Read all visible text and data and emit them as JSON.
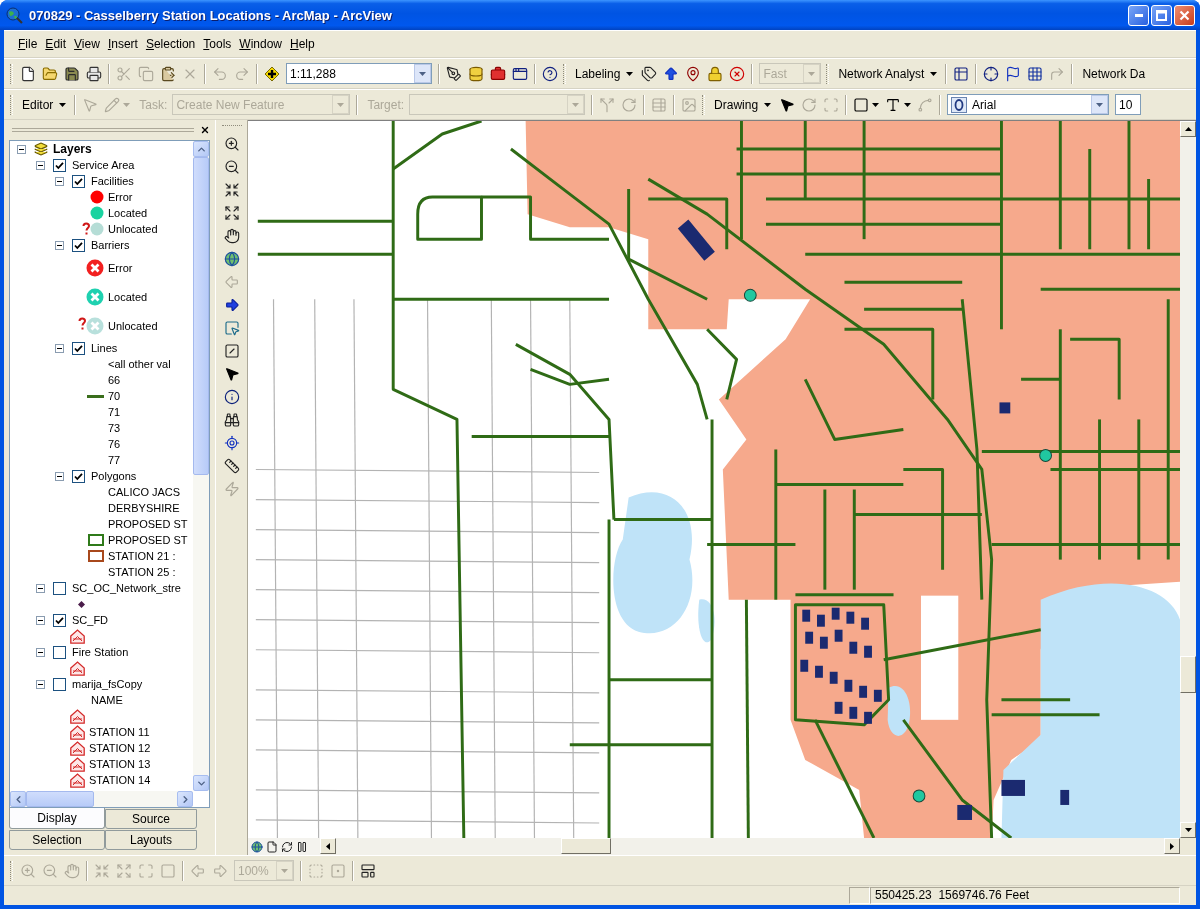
{
  "window": {
    "title": "070829 - Casselberry Station Locations - ArcMap - ArcView"
  },
  "menu_bar": [
    "File",
    "Edit",
    "View",
    "Insert",
    "Selection",
    "Tools",
    "Window",
    "Help"
  ],
  "standard_toolbar": {
    "tools": [
      {
        "disabled": false
      },
      {
        "disabled": false
      },
      {
        "disabled": false
      },
      {
        "disabled": false
      },
      {
        "disabled": true
      },
      {
        "disabled": true
      },
      {
        "disabled": false
      },
      {
        "disabled": true
      },
      {
        "disabled": true
      },
      {
        "disabled": true
      },
      {
        "disabled": false
      },
      {
        "disabled": false
      },
      {
        "disabled": false
      },
      {
        "disabled": false
      },
      {
        "disabled": false
      },
      {
        "disabled": false
      },
      {
        "disabled": false
      },
      {
        "disabled": false
      },
      {
        "disabled": false
      },
      {
        "disabled": false
      },
      {
        "disabled": false
      },
      {
        "disabled": false
      },
      {
        "disabled": false
      },
      {
        "disabled": false
      },
      {
        "disabled": false
      },
      {
        "disabled": true
      }
    ],
    "scale": "1:11,288",
    "labeling_menu": "Labeling",
    "priority_combo": {
      "value": "Fast",
      "disabled": true
    },
    "network_analyst_menu": "Network Analyst",
    "network_dataset_label": "Network Da"
  },
  "editor_toolbar": {
    "editor_menu": "Editor",
    "tools": [
      {
        "disabled": true
      },
      {
        "disabled": true
      },
      {
        "disabled": true
      },
      {
        "disabled": true
      },
      {
        "disabled": true
      },
      {
        "disabled": true
      },
      {
        "disabled": false
      },
      {
        "disabled": true
      },
      {
        "disabled": true
      },
      {
        "disabled": false
      },
      {
        "disabled": false
      },
      {
        "disabled": true
      }
    ],
    "task": {
      "label": "Task:",
      "value": "Create New Feature",
      "disabled": true
    },
    "target": {
      "label": "Target:",
      "disabled": true
    },
    "drawing_menu": "Drawing",
    "font": "Arial",
    "font_size": "10"
  },
  "tools_column": {
    "tools": [
      {
        "disabled": false
      },
      {
        "disabled": false
      },
      {
        "disabled": false
      },
      {
        "disabled": false
      },
      {
        "disabled": false
      },
      {
        "disabled": false
      },
      {
        "disabled": true
      },
      {
        "disabled": false
      },
      {
        "disabled": false
      },
      {
        "disabled": false
      },
      {
        "disabled": false
      },
      {
        "disabled": false
      },
      {
        "disabled": false
      },
      {
        "disabled": false
      },
      {
        "disabled": false
      },
      {
        "disabled": true
      }
    ]
  },
  "table_of_contents": {
    "tree": [
      {
        "kind": "data-frame",
        "label": "Layers",
        "expanded": true,
        "children": [
          {
            "kind": "layer",
            "label": "Service Area",
            "checked": true,
            "expanded": true,
            "children": [
              {
                "kind": "layer",
                "label": "Facilities",
                "checked": true,
                "expanded": true,
                "children": [
                  {
                    "kind": "point",
                    "label": "Error",
                    "color": "#ff0000"
                  },
                  {
                    "kind": "point",
                    "label": "Located",
                    "color": "#19d3a0"
                  },
                  {
                    "kind": "unlocated-point",
                    "label": "Unlocated",
                    "color": "#b5ddd6"
                  }
                ]
              },
              {
                "kind": "layer",
                "label": "Barriers",
                "checked": true,
                "expanded": true,
                "children": [
                  {
                    "kind": "barrier",
                    "label": "Error",
                    "color": "#f22020"
                  },
                  {
                    "kind": "barrier",
                    "label": "Located",
                    "color": "#1fd1b0"
                  },
                  {
                    "kind": "unlocated-barrier",
                    "label": "Unlocated",
                    "color": "#b8e0dc"
                  }
                ]
              },
              {
                "kind": "layer",
                "label": "Lines",
                "checked": true,
                "expanded": true,
                "children": [
                  {
                    "kind": "value",
                    "label": "<all other val"
                  },
                  {
                    "kind": "value",
                    "label": "66"
                  },
                  {
                    "kind": "line",
                    "label": "70",
                    "color": "#3a6e1c"
                  },
                  {
                    "kind": "value",
                    "label": "71"
                  },
                  {
                    "kind": "value",
                    "label": "73"
                  },
                  {
                    "kind": "value",
                    "label": "76"
                  },
                  {
                    "kind": "value",
                    "label": "77"
                  }
                ]
              },
              {
                "kind": "layer",
                "label": "Polygons",
                "checked": true,
                "expanded": true,
                "children": [
                  {
                    "kind": "value",
                    "label": "CALICO JACS"
                  },
                  {
                    "kind": "value",
                    "label": "DERBYSHIRE"
                  },
                  {
                    "kind": "value",
                    "label": "PROPOSED ST"
                  },
                  {
                    "kind": "outline",
                    "label": "PROPOSED ST",
                    "color": "#2f7a1a"
                  },
                  {
                    "kind": "outline",
                    "label": "STATION 21 :",
                    "color": "#a8481c"
                  },
                  {
                    "kind": "value",
                    "label": "STATION 25 :"
                  }
                ]
              }
            ]
          },
          {
            "kind": "layer",
            "label": "SC_OC_Network_stre",
            "checked": false,
            "expanded": true,
            "children": [
              {
                "kind": "diamond",
                "color": "#4a1c4a"
              }
            ]
          },
          {
            "kind": "layer",
            "label": "SC_FD",
            "checked": true,
            "expanded": true,
            "children": [
              {
                "kind": "fire-station"
              }
            ]
          },
          {
            "kind": "layer",
            "label": "Fire Station",
            "checked": false,
            "expanded": true,
            "children": [
              {
                "kind": "fire-station"
              }
            ]
          },
          {
            "kind": "layer",
            "label": "marija_fsCopy",
            "checked": false,
            "expanded": true,
            "children": [
              {
                "kind": "heading",
                "label": "NAME"
              },
              {
                "kind": "fire-station"
              },
              {
                "kind": "fire-station",
                "label": "STATION 11"
              },
              {
                "kind": "fire-station",
                "label": "STATION 12"
              },
              {
                "kind": "fire-station",
                "label": "STATION 13"
              },
              {
                "kind": "fire-station",
                "label": "STATION 14"
              }
            ]
          }
        ]
      }
    ],
    "tabs": [
      {
        "label": "Display",
        "selected": true
      },
      {
        "label": "Source",
        "selected": false
      },
      {
        "label": "Selection",
        "selected": false
      },
      {
        "label": "Layouts",
        "selected": false
      }
    ]
  },
  "layout_toolbar": {
    "tools": [
      {
        "disabled": true
      },
      {
        "disabled": true
      },
      {
        "disabled": true
      },
      {
        "disabled": true
      },
      {
        "disabled": true
      },
      {
        "disabled": true
      },
      {
        "disabled": true
      },
      {
        "disabled": true
      },
      {
        "disabled": true
      },
      {
        "disabled": true
      },
      {
        "disabled": true
      },
      {
        "disabled": false
      }
    ],
    "zoom_combo": {
      "value": "100%",
      "disabled": true
    }
  },
  "status_bar": {
    "coordinates": "550425.23  1569746.76 Feet"
  }
}
